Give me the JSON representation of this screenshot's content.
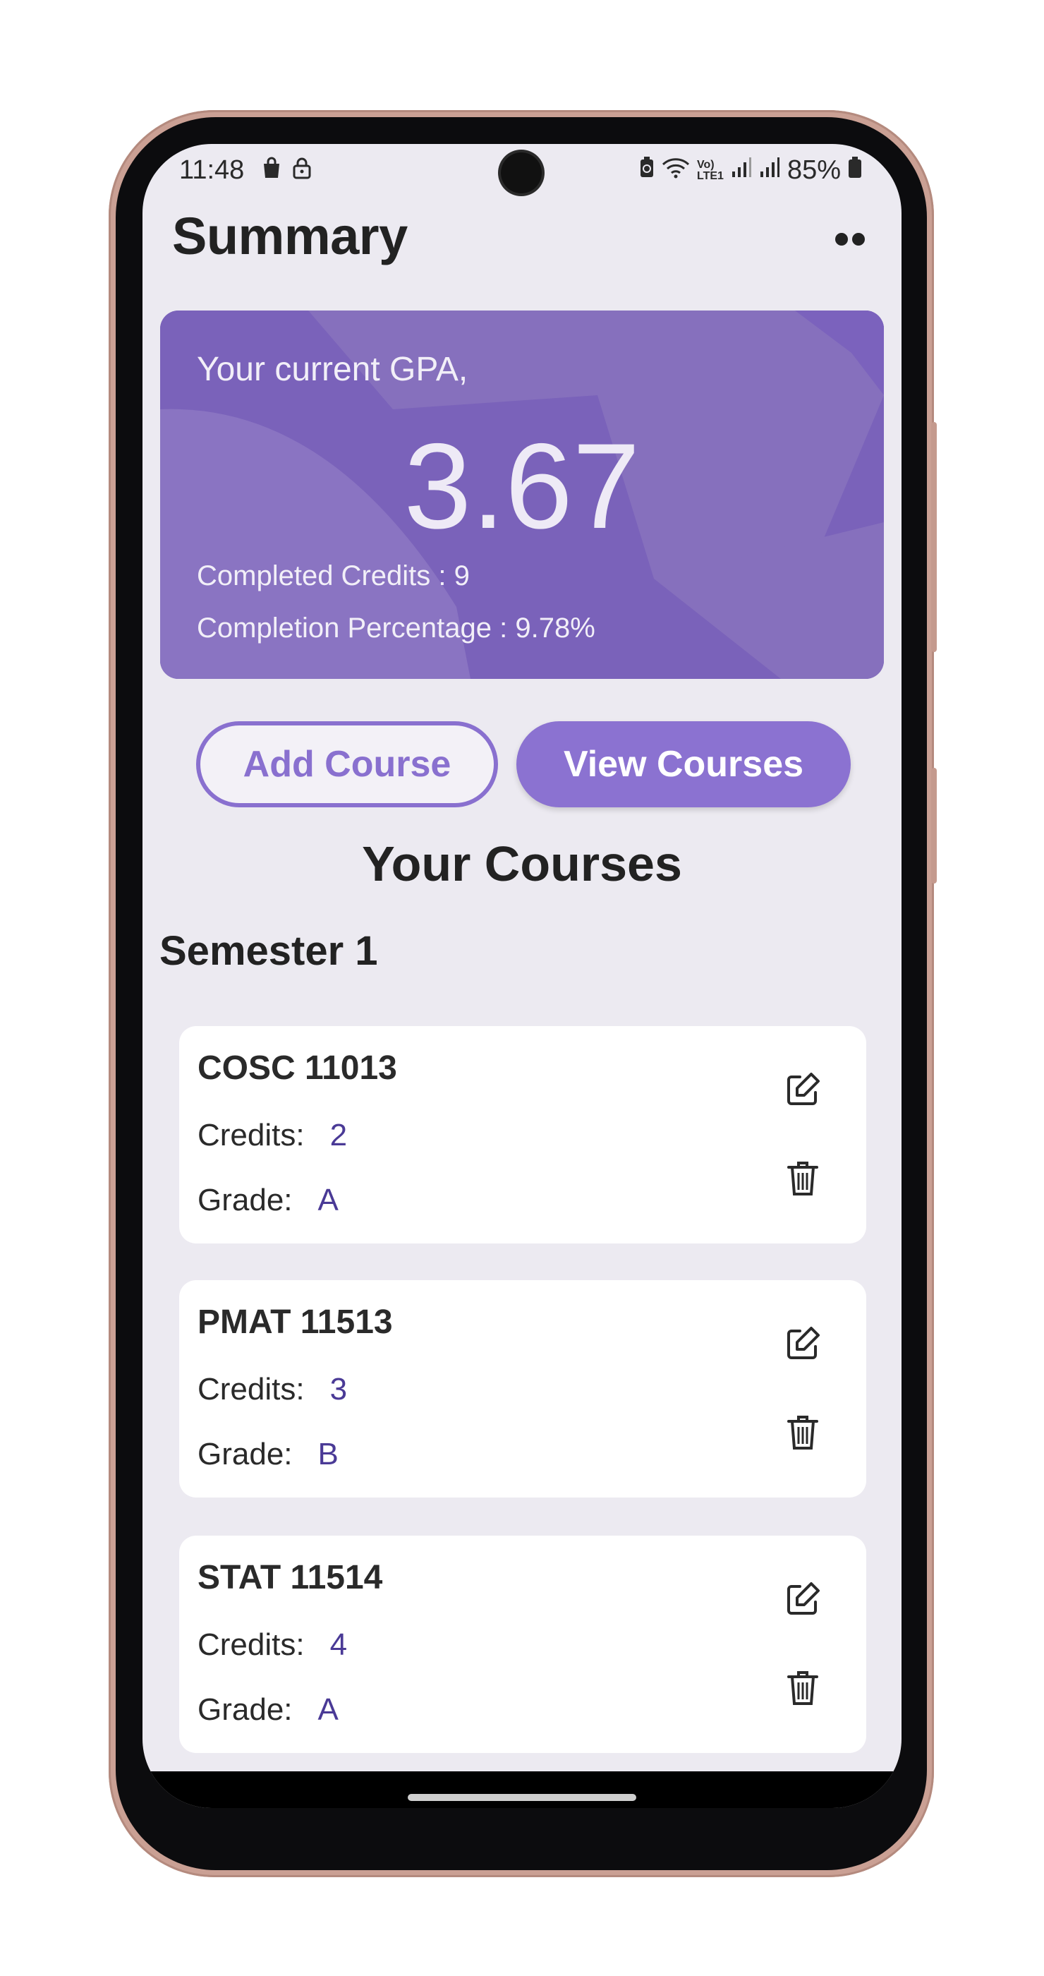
{
  "status_bar": {
    "time": "11:48",
    "left_icons": [
      "shopping-bag-icon",
      "lock-icon"
    ],
    "right_icons": [
      "battery-saver-icon",
      "wifi-icon",
      "volte-icon",
      "signal-icon",
      "signal-icon"
    ],
    "battery": "85%"
  },
  "app_bar": {
    "title": "Summary",
    "menu_icon": "overflow-menu-icon"
  },
  "gpa_card": {
    "label": "Your current GPA,",
    "value": "3.67",
    "completed_credits": "Completed Credits : 9",
    "completion_percentage": "Completion Percentage : 9.78%",
    "color": "#7b63bc"
  },
  "actions": {
    "add_course": "Add Course",
    "view_courses": "View Courses",
    "accent": "#8b72d1"
  },
  "courses_heading": "Your Courses",
  "semesters": [
    {
      "title": "Semester 1",
      "courses": [
        {
          "code": "COSC 11013",
          "credits_label": "Credits:",
          "credits": "2",
          "grade_label": "Grade:",
          "grade": "A"
        },
        {
          "code": "PMAT 11513",
          "credits_label": "Credits:",
          "credits": "3",
          "grade_label": "Grade:",
          "grade": "B"
        },
        {
          "code": "STAT 11514",
          "credits_label": "Credits:",
          "credits": "4",
          "grade_label": "Grade:",
          "grade": "A"
        }
      ]
    }
  ]
}
